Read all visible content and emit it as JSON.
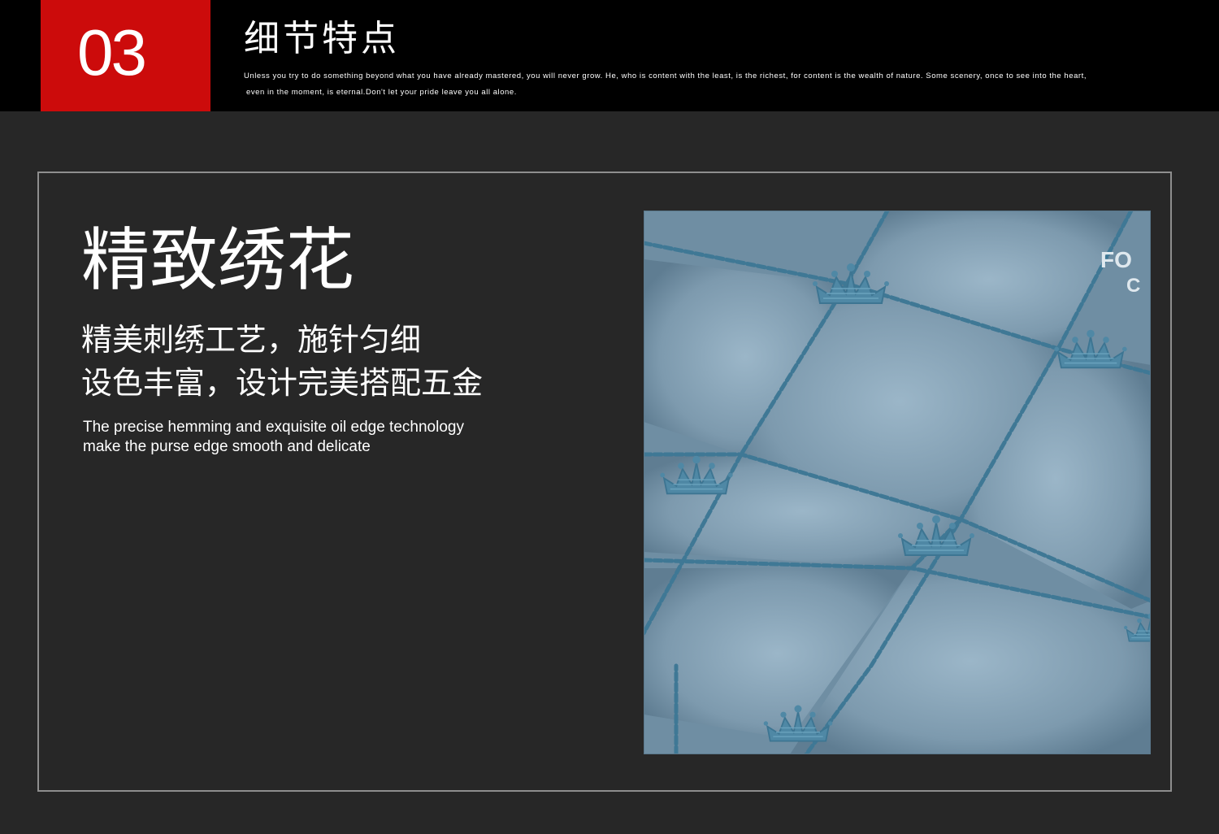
{
  "header": {
    "number": "03",
    "title": "细节特点",
    "subtitle_lines": [
      "Unless you try to do something beyond what you have already mastered, you will never grow. He, who is content with the least, is the richest, for content is the wealth of nature. Some scenery, once to see into the heart,",
      "even in the moment, is eternal.Don't let your pride leave you all alone."
    ]
  },
  "feature": {
    "title": "精致绣花",
    "desc_lines": [
      "精美刺绣工艺，施针匀细",
      "设色丰富，设计完美搭配五金"
    ],
    "desc_en_lines": [
      "The precise hemming and exquisite oil edge technology",
      "make the purse edge smooth and delicate"
    ]
  },
  "photo": {
    "subject": "blue-quilted-leather-crown-embroidery",
    "corner_text": [
      "FO",
      "C"
    ]
  },
  "colors": {
    "background": "#272727",
    "header_bar": "#000000",
    "accent_red": "#cc0b0b",
    "frame_border": "#8e8e8e",
    "leather": "#7f9db1",
    "stitch": "#3f7895"
  }
}
